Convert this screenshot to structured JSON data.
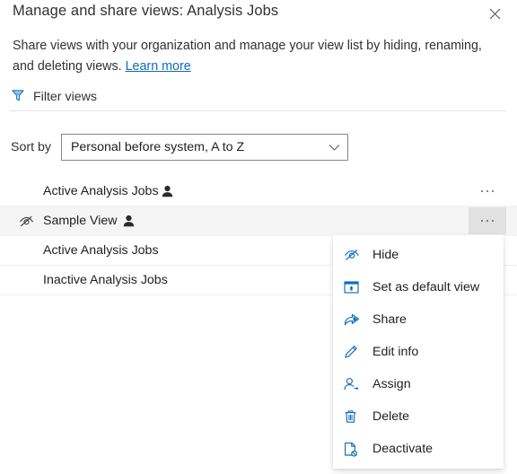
{
  "header": {
    "title": "Manage and share views: Analysis Jobs",
    "close_icon": "close-icon"
  },
  "description": {
    "text": "Share views with your organization and manage your view list by hiding, renaming, and deleting views. ",
    "link_text": "Learn more"
  },
  "filter": {
    "label": "Filter views",
    "icon": "filter-icon",
    "accent_color": "#0f6cbd"
  },
  "sort": {
    "label": "Sort by",
    "selected_value": "Personal before system, A to Z",
    "chevron_icon": "chevron-down-icon"
  },
  "view_list": {
    "rows": [
      {
        "name": "Active Analysis Jobs",
        "personal": true,
        "hidden": false,
        "selected": false,
        "name_width": 128
      },
      {
        "name": "Sample View",
        "personal": true,
        "hidden": true,
        "selected": true,
        "name_width": 84
      },
      {
        "name": "Active Analysis Jobs",
        "personal": false,
        "hidden": false,
        "selected": false,
        "name_width": 128
      },
      {
        "name": "Inactive Analysis Jobs",
        "personal": false,
        "hidden": false,
        "selected": false,
        "name_width": 138
      }
    ],
    "more_label": "more-options"
  },
  "context_menu": {
    "items": [
      {
        "label": "Hide",
        "icon": "hide-eye-slash-icon"
      },
      {
        "label": "Set as default view",
        "icon": "set-default-view-icon"
      },
      {
        "label": "Share",
        "icon": "share-icon"
      },
      {
        "label": "Edit info",
        "icon": "edit-pencil-icon"
      },
      {
        "label": "Assign",
        "icon": "assign-person-icon"
      },
      {
        "label": "Delete",
        "icon": "delete-trash-icon"
      },
      {
        "label": "Deactivate",
        "icon": "deactivate-page-icon"
      }
    ],
    "accent_color": "#0f6cbd"
  },
  "colors": {
    "accent": "#0f6cbd",
    "text": "#323130",
    "selected_row_bg": "#f5f5f5",
    "more_button_active_bg": "#e1e1e1",
    "divider": "#e6e6e6"
  }
}
